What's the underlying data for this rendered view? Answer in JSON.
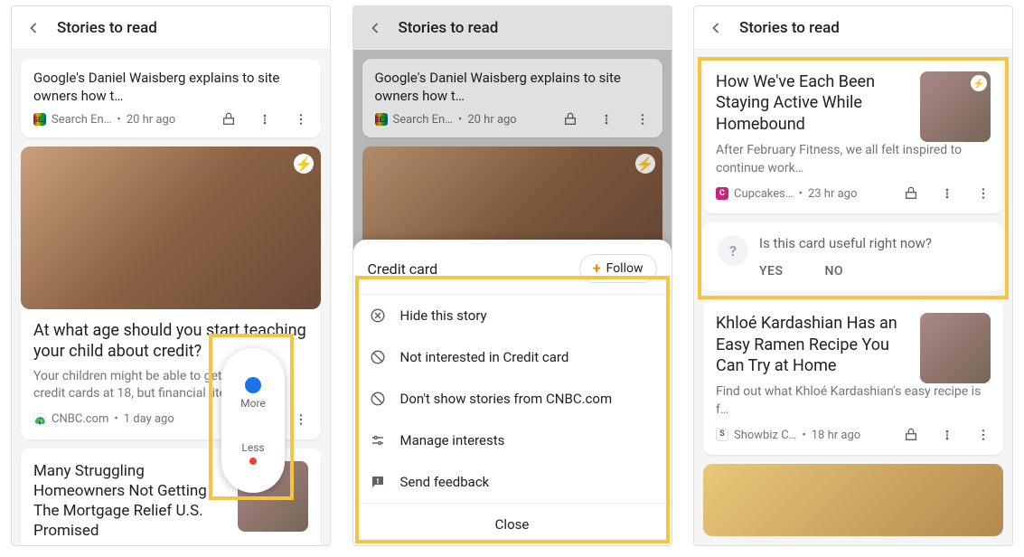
{
  "header": {
    "title": "Stories to read"
  },
  "panel1": {
    "card1": {
      "snippet": "Google's Daniel Waisberg explains to site owners how t…",
      "publisher": "Search En…",
      "time": "20 hr ago"
    },
    "card2": {
      "title": "At what age should you start teaching your child about credit?",
      "snippet": "Your children might be able to get their first credit cards at 18, but financial literacy e…",
      "publisher": "CNBC.com",
      "time": "1 day ago"
    },
    "card3": {
      "title": "Many Struggling Homeowners Not Getting The Mortgage Relief U.S. Promised"
    },
    "moreless": {
      "more": "More",
      "less": "Less"
    }
  },
  "panel2": {
    "card1": {
      "snippet": "Google's Daniel Waisberg explains to site owners how t…",
      "publisher": "Search En…",
      "time": "20 hr ago"
    },
    "sheet": {
      "topic": "Credit card",
      "follow": "Follow",
      "rows": {
        "hide": "Hide this story",
        "notInterested": "Not interested in Credit card",
        "dontShow": "Don't show stories from CNBC.com",
        "manage": "Manage interests",
        "feedback": "Send feedback"
      },
      "close": "Close"
    }
  },
  "panel3": {
    "card1": {
      "title": "How We've Each Been Staying Active While Homebound",
      "snippet": "After February Fitness, we all felt inspired to continue work…",
      "publisher": "Cupcakes…",
      "time": "23 hr ago"
    },
    "feedback": {
      "question": "Is this card useful right now?",
      "yes": "YES",
      "no": "NO"
    },
    "card2": {
      "title": "Khloé Kardashian Has an Easy Ramen Recipe You Can Try at Home",
      "snippet": "Find out what Khloé Kardashian's easy recipe is f…",
      "publisher": "Showbiz C…",
      "time": "18 hr ago"
    }
  }
}
